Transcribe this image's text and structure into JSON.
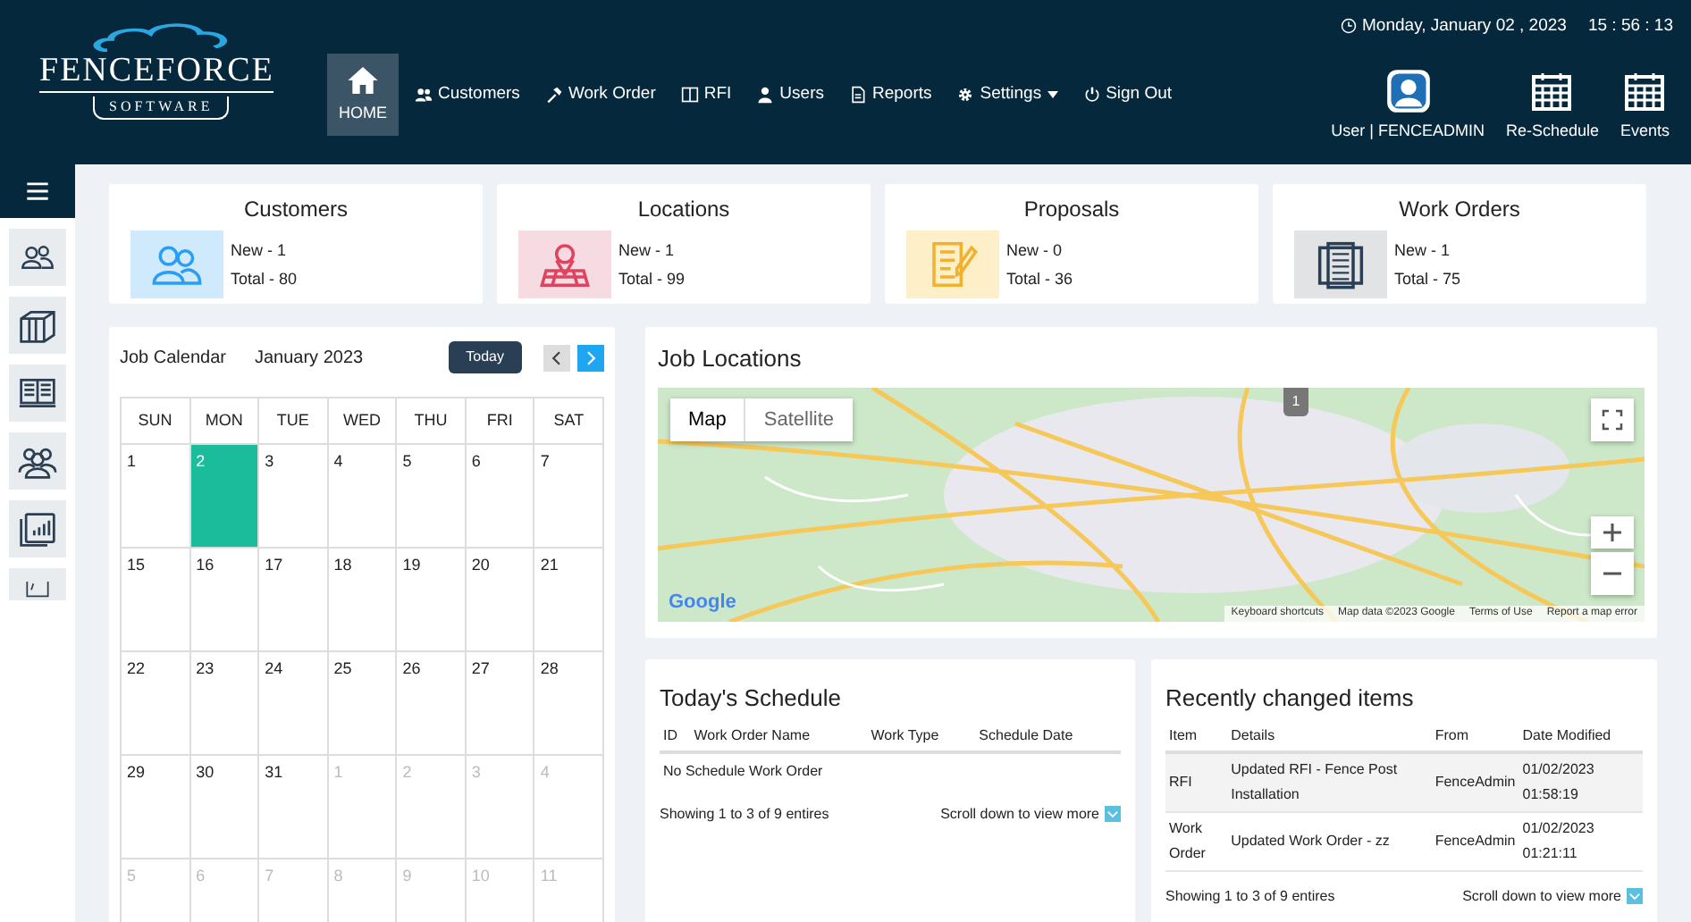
{
  "header": {
    "logo": {
      "brand": "FENCEFORCE",
      "tagline": "SOFTWARE"
    },
    "date": "Monday, January 02 , 2023",
    "clock": "15 : 56 : 13",
    "nav": [
      {
        "label": "HOME",
        "kind": "home",
        "selected": true,
        "dropdown": false
      },
      {
        "label": "Customers",
        "kind": "customers",
        "selected": false,
        "dropdown": false
      },
      {
        "label": "Work Order",
        "kind": "hammer",
        "selected": false,
        "dropdown": false
      },
      {
        "label": "RFI",
        "kind": "columns",
        "selected": false,
        "dropdown": false
      },
      {
        "label": "Users",
        "kind": "user",
        "selected": false,
        "dropdown": false
      },
      {
        "label": "Reports",
        "kind": "report",
        "selected": false,
        "dropdown": false
      },
      {
        "label": "Settings",
        "kind": "settings",
        "selected": false,
        "dropdown": true
      },
      {
        "label": "Sign Out",
        "kind": "power",
        "selected": false,
        "dropdown": false
      }
    ],
    "actions": [
      {
        "label": "User | FENCEADMIN",
        "kind": "avatar"
      },
      {
        "label": "Re-Schedule",
        "kind": "calendar"
      },
      {
        "label": "Events",
        "kind": "calendar"
      }
    ]
  },
  "stats": [
    {
      "title": "Customers",
      "kind": "customers",
      "new": "New - 1",
      "total": "Total - 80"
    },
    {
      "title": "Locations",
      "kind": "locations",
      "new": "New - 1",
      "total": "Total - 99"
    },
    {
      "title": "Proposals",
      "kind": "proposals",
      "new": "New - 0",
      "total": "Total - 36"
    },
    {
      "title": "Work Orders",
      "kind": "workorders",
      "new": "New - 1",
      "total": "Total - 75"
    }
  ],
  "calendar": {
    "title": "Job Calendar",
    "month": "January 2023",
    "today": "Today",
    "weekdays": [
      "SUN",
      "MON",
      "TUE",
      "WED",
      "THU",
      "FRI",
      "SAT"
    ],
    "weeks": [
      [
        {
          "label": "1",
          "muted": false,
          "selected": false
        },
        {
          "label": "2",
          "muted": false,
          "selected": true
        },
        {
          "label": "3",
          "muted": false,
          "selected": false
        },
        {
          "label": "4",
          "muted": false,
          "selected": false
        },
        {
          "label": "5",
          "muted": false,
          "selected": false
        },
        {
          "label": "6",
          "muted": false,
          "selected": false
        },
        {
          "label": "7",
          "muted": false,
          "selected": false
        }
      ],
      [
        {
          "label": "15",
          "muted": false,
          "selected": false
        },
        {
          "label": "16",
          "muted": false,
          "selected": false
        },
        {
          "label": "17",
          "muted": false,
          "selected": false
        },
        {
          "label": "18",
          "muted": false,
          "selected": false
        },
        {
          "label": "19",
          "muted": false,
          "selected": false
        },
        {
          "label": "20",
          "muted": false,
          "selected": false
        },
        {
          "label": "21",
          "muted": false,
          "selected": false
        }
      ],
      [
        {
          "label": "22",
          "muted": false,
          "selected": false
        },
        {
          "label": "23",
          "muted": false,
          "selected": false
        },
        {
          "label": "24",
          "muted": false,
          "selected": false
        },
        {
          "label": "25",
          "muted": false,
          "selected": false
        },
        {
          "label": "26",
          "muted": false,
          "selected": false
        },
        {
          "label": "27",
          "muted": false,
          "selected": false
        },
        {
          "label": "28",
          "muted": false,
          "selected": false
        }
      ],
      [
        {
          "label": "29",
          "muted": false,
          "selected": false
        },
        {
          "label": "30",
          "muted": false,
          "selected": false
        },
        {
          "label": "31",
          "muted": false,
          "selected": false
        },
        {
          "label": "1",
          "muted": true,
          "selected": false
        },
        {
          "label": "2",
          "muted": true,
          "selected": false
        },
        {
          "label": "3",
          "muted": true,
          "selected": false
        },
        {
          "label": "4",
          "muted": true,
          "selected": false
        }
      ],
      [
        {
          "label": "5",
          "muted": true,
          "selected": false
        },
        {
          "label": "6",
          "muted": true,
          "selected": false
        },
        {
          "label": "7",
          "muted": true,
          "selected": false
        },
        {
          "label": "8",
          "muted": true,
          "selected": false
        },
        {
          "label": "9",
          "muted": true,
          "selected": false
        },
        {
          "label": "10",
          "muted": true,
          "selected": false
        },
        {
          "label": "11",
          "muted": true,
          "selected": false
        }
      ]
    ]
  },
  "map": {
    "title": "Job Locations",
    "map_types": [
      {
        "label": "Map",
        "selected": true
      },
      {
        "label": "Satellite",
        "selected": false
      }
    ],
    "marker": "1",
    "logo": "Google",
    "attribution": [
      "Keyboard shortcuts",
      "Map data ©2023 Google",
      "Terms of Use",
      "Report a map error"
    ]
  },
  "schedule": {
    "title": "Today's Schedule",
    "columns": [
      "ID",
      "Work Order Name",
      "Work Type",
      "Schedule Date"
    ],
    "empty": "No Schedule Work Order",
    "footer": "Showing 1 to 3 of 9 entires",
    "more": "Scroll down to view more"
  },
  "recent": {
    "title": "Recently changed items",
    "columns": [
      "Item",
      "Details",
      "From",
      "Date Modified"
    ],
    "rows": [
      [
        "RFI",
        "Updated RFI - Fence Post Installation",
        "FenceAdmin",
        "01/02/2023 01:58:19"
      ],
      [
        "Work Order",
        "Updated Work Order - zz",
        "FenceAdmin",
        "01/02/2023 01:21:11"
      ]
    ],
    "footer": "Showing 1 to 3 of 9 entires",
    "more": "Scroll down to view more"
  }
}
